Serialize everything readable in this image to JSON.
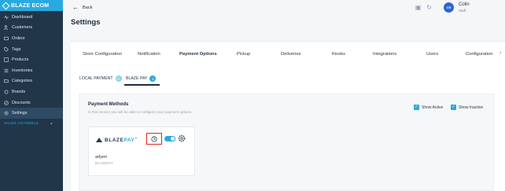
{
  "brand": {
    "name": "BLAZE ECOM"
  },
  "sidebar": {
    "items": [
      {
        "label": "Dashboard",
        "icon": "pulse-icon"
      },
      {
        "label": "Customers",
        "icon": "users-icon"
      },
      {
        "label": "Orders",
        "icon": "cart-icon"
      },
      {
        "label": "Tags",
        "icon": "tag-icon"
      },
      {
        "label": "Products",
        "icon": "box-icon"
      },
      {
        "label": "Inventories",
        "icon": "list-icon"
      },
      {
        "label": "Categories",
        "icon": "folder-icon"
      },
      {
        "label": "Brands",
        "icon": "badge-icon"
      },
      {
        "label": "Discounts",
        "icon": "percent-icon"
      },
      {
        "label": "Settings",
        "icon": "gear-icon"
      }
    ],
    "active_index": 9,
    "sales_channels": "SALES CHANNELS"
  },
  "header": {
    "back_label": "Back",
    "user": {
      "initials": "CR",
      "name": "Colin",
      "role": "Staff"
    }
  },
  "page": {
    "title": "Settings"
  },
  "tabs": [
    {
      "label": "Store Configuration"
    },
    {
      "label": "Notification"
    },
    {
      "label": "Payment Options"
    },
    {
      "label": "Pickup"
    },
    {
      "label": "Deliveries"
    },
    {
      "label": "Kiosks"
    },
    {
      "label": "Integrations"
    },
    {
      "label": "Users"
    },
    {
      "label": "Configuration"
    }
  ],
  "active_tab": "Payment Options",
  "subtabs": [
    {
      "label": "LOCAL PAYMENT",
      "count": "0"
    },
    {
      "label": "BLAZE PAY",
      "count": "1"
    }
  ],
  "payment_methods": {
    "title": "Payment Methods",
    "description": "In this section you will be able to configure your payment options.",
    "show_active": "Show Active",
    "show_inactive": "Show Inactive"
  },
  "provider": {
    "logo_text": "BLAZEPAY",
    "name": "adyen",
    "type": "BLAZEPAY",
    "enabled": true
  },
  "colors": {
    "accent": "#2aa9e0",
    "sidebar": "#22364a",
    "highlight": "#e0281e"
  }
}
